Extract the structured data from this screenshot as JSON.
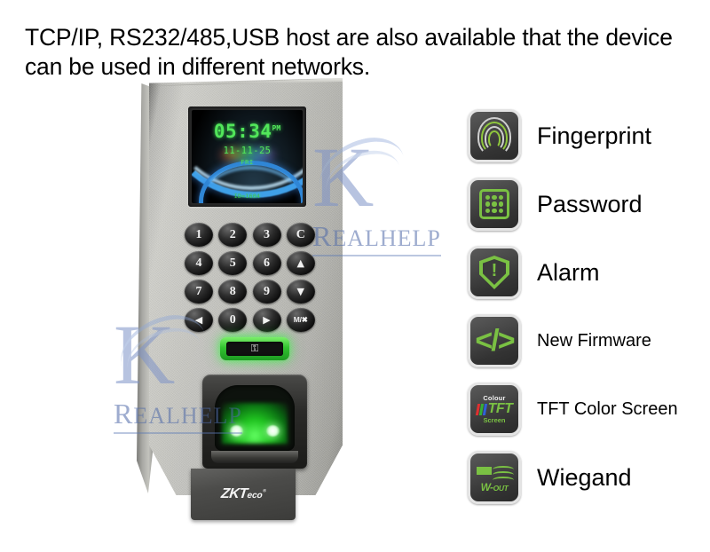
{
  "heading": {
    "text": "TCP/IP, RS232/485,USB host are also available that the device can be used in different networks."
  },
  "device": {
    "brand": "ZKT",
    "brand_suffix": "eco",
    "brand_reg": "®",
    "screen": {
      "time": "05:34",
      "ampm": "PM",
      "date": "11-11-25",
      "weekday": "FRI",
      "id": "ID=1604"
    },
    "keypad": [
      {
        "name": "key-1",
        "label": "1",
        "kind": "digit"
      },
      {
        "name": "key-2",
        "label": "2",
        "kind": "digit"
      },
      {
        "name": "key-3",
        "label": "3",
        "kind": "digit"
      },
      {
        "name": "key-clear",
        "label": "C",
        "kind": "digit"
      },
      {
        "name": "key-4",
        "label": "4",
        "kind": "digit"
      },
      {
        "name": "key-5",
        "label": "5",
        "kind": "digit"
      },
      {
        "name": "key-6",
        "label": "6",
        "kind": "digit"
      },
      {
        "name": "key-up-arrow",
        "label": "▲",
        "kind": "sym"
      },
      {
        "name": "key-7",
        "label": "7",
        "kind": "digit"
      },
      {
        "name": "key-8",
        "label": "8",
        "kind": "digit"
      },
      {
        "name": "key-9",
        "label": "9",
        "kind": "digit"
      },
      {
        "name": "key-down-arrow",
        "label": "▼",
        "kind": "sym"
      },
      {
        "name": "key-left-arrow",
        "label": "◀",
        "kind": "sym"
      },
      {
        "name": "key-0",
        "label": "0",
        "kind": "digit"
      },
      {
        "name": "key-right-arrow",
        "label": "▶",
        "kind": "sym"
      },
      {
        "name": "key-menu-escape",
        "label": "M/✖",
        "kind": "mk"
      }
    ],
    "lock_indicator": {
      "glyph": "⚿",
      "state_color": "#3fd840"
    },
    "fingerprint_sensor": {
      "glow_color": "#4dff4d"
    }
  },
  "features": [
    {
      "icon": "fingerprint-icon",
      "label": "Fingerprint",
      "size": "lg",
      "accent": "#8fc63d"
    },
    {
      "icon": "password-keypad-icon",
      "label": "Password",
      "size": "lg",
      "accent": "#7ac143"
    },
    {
      "icon": "alarm-shield-icon",
      "label": "Alarm",
      "size": "lg",
      "accent": "#7ac143"
    },
    {
      "icon": "code-brackets-icon",
      "label": "New Firmware",
      "size": "sm",
      "accent": "#7ac143"
    },
    {
      "icon": "tft-screen-icon",
      "label": "TFT Color Screen",
      "size": "sm",
      "accent": "#7ac143"
    },
    {
      "icon": "wiegand-out-icon",
      "label": "Wiegand",
      "size": "lg",
      "accent": "#7ac143"
    }
  ],
  "tft_icon_text": {
    "top": "Colour",
    "mid": "TFT",
    "bottom": "Screen"
  },
  "wiegand_icon_text": {
    "w": "W-",
    "out": "OUT"
  },
  "watermark": {
    "letter": "K",
    "cap": "R",
    "rest": "EALHELP",
    "color": "#4f6aa8"
  }
}
